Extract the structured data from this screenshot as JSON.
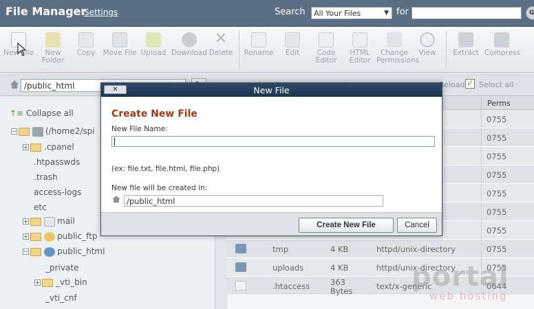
{
  "header": {
    "title": "File Manager",
    "settings_link": "Settings",
    "search_label": "Search",
    "search_scope": "All Your Files",
    "for_label": "for",
    "search_value": "",
    "go_label": "Go"
  },
  "toolbar": {
    "items": [
      {
        "label": "New File",
        "icon": "new-file-icon"
      },
      {
        "label": "New Folder",
        "icon": "new-folder-icon"
      },
      {
        "label": "Copy",
        "icon": "copy-icon"
      },
      {
        "label": "Move File",
        "icon": "move-file-icon"
      },
      {
        "label": "Upload",
        "icon": "upload-icon"
      },
      {
        "label": "Download",
        "icon": "download-icon"
      },
      {
        "label": "Delete",
        "icon": "delete-icon"
      },
      {
        "label": "Rename",
        "icon": "rename-icon"
      },
      {
        "label": "Edit",
        "icon": "edit-icon"
      },
      {
        "label": "Code Editor",
        "icon": "code-editor-icon"
      },
      {
        "label": "HTML Editor",
        "icon": "html-editor-icon"
      },
      {
        "label": "Change Permissions",
        "icon": "change-permissions-icon"
      },
      {
        "label": "View",
        "icon": "view-icon"
      },
      {
        "label": "Extract",
        "icon": "extract-icon"
      },
      {
        "label": "Compress",
        "icon": "compress-icon"
      }
    ]
  },
  "pathbar": {
    "path": "/public_html",
    "go_label": "Go"
  },
  "tree": {
    "collapse_all": "Collapse all",
    "root": "(/home2/spi",
    "items": [
      ".cpanel",
      ".htpasswds",
      ".trash",
      "access-logs",
      "etc",
      "mail",
      "public_ftp",
      "public_html",
      "_private",
      "_vti_bin",
      "_vti_cnf"
    ]
  },
  "filelist": {
    "reload_label": "Reload",
    "select_all_label": "Select all",
    "perms_header": "Perms",
    "rows": [
      {
        "name": "",
        "size": "",
        "type": "",
        "perms": "0755"
      },
      {
        "name": "",
        "size": "",
        "type": "",
        "perms": "0755"
      },
      {
        "name": "",
        "size": "",
        "type": "",
        "perms": "0755"
      },
      {
        "name": "",
        "size": "",
        "type": "",
        "perms": "0755"
      },
      {
        "name": "",
        "size": "",
        "type": "",
        "perms": "0755"
      },
      {
        "name": "",
        "size": "",
        "type": "",
        "perms": "0755"
      },
      {
        "name": "",
        "size": "",
        "type": "",
        "perms": "0755"
      },
      {
        "name": "tmp",
        "size": "4 KB",
        "type": "httpd/unix-directory",
        "perms": "0755"
      },
      {
        "name": "uploads",
        "size": "4 KB",
        "type": "httpd/unix-directory",
        "perms": "0755"
      },
      {
        "name": ".htaccess",
        "size": "363 Bytes",
        "type": "text/x-generic",
        "perms": "0644"
      }
    ]
  },
  "watermark": {
    "main": "portal",
    "sub": "web hosting"
  },
  "dialog": {
    "title": "New File",
    "close_label": "✕",
    "heading": "Create New File",
    "name_label": "New File Name:",
    "name_value": "",
    "name_hint": "(ex: file.txt, file.html, file.php)",
    "location_label": "New file will be created in:",
    "location_value": "/public_html",
    "create_button": "Create New File",
    "cancel_button": "Cancel"
  },
  "colors": {
    "header_bg": "#5a6e84",
    "dialog_title_bg": "#1c3450",
    "heading_color": "#9a3b16"
  }
}
